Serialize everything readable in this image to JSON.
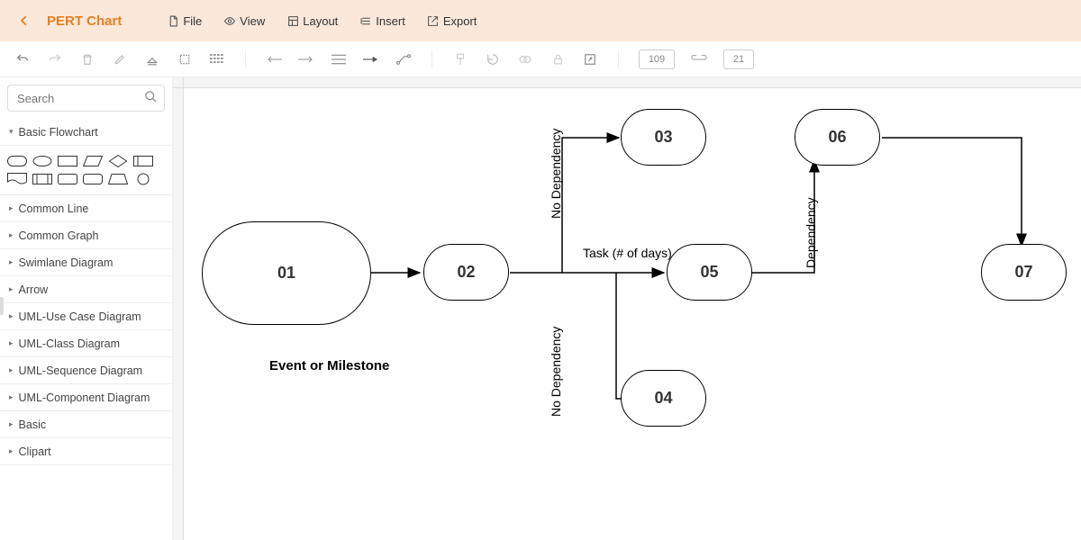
{
  "header": {
    "title": "PERT Chart",
    "menu": [
      {
        "label": "File",
        "icon": "file-icon"
      },
      {
        "label": "View",
        "icon": "eye-icon"
      },
      {
        "label": "Layout",
        "icon": "layout-icon"
      },
      {
        "label": "Insert",
        "icon": "insert-icon"
      },
      {
        "label": "Export",
        "icon": "export-icon"
      }
    ]
  },
  "toolbar": {
    "width_value": "109",
    "height_value": "21"
  },
  "sidebar": {
    "search_placeholder": "Search",
    "sections": [
      {
        "label": "Basic Flowchart",
        "open": true
      },
      {
        "label": "Common Line"
      },
      {
        "label": "Common Graph"
      },
      {
        "label": "Swimlane Diagram"
      },
      {
        "label": "Arrow"
      },
      {
        "label": "UML-Use Case Diagram"
      },
      {
        "label": "UML-Class Diagram"
      },
      {
        "label": "UML-Sequence Diagram"
      },
      {
        "label": "UML-Component Diagram"
      },
      {
        "label": "Basic"
      },
      {
        "label": "Clipart"
      }
    ]
  },
  "diagram": {
    "nodes": {
      "n01": "01",
      "n02": "02",
      "n03": "03",
      "n04": "04",
      "n05": "05",
      "n06": "06",
      "n07": "07"
    },
    "labels": {
      "milestone": "Event or Milestone",
      "task": "Task (# of days)",
      "no_dep_top": "No Dependency",
      "no_dep_bottom": "No Dependency",
      "dependency": "Dependency"
    }
  }
}
